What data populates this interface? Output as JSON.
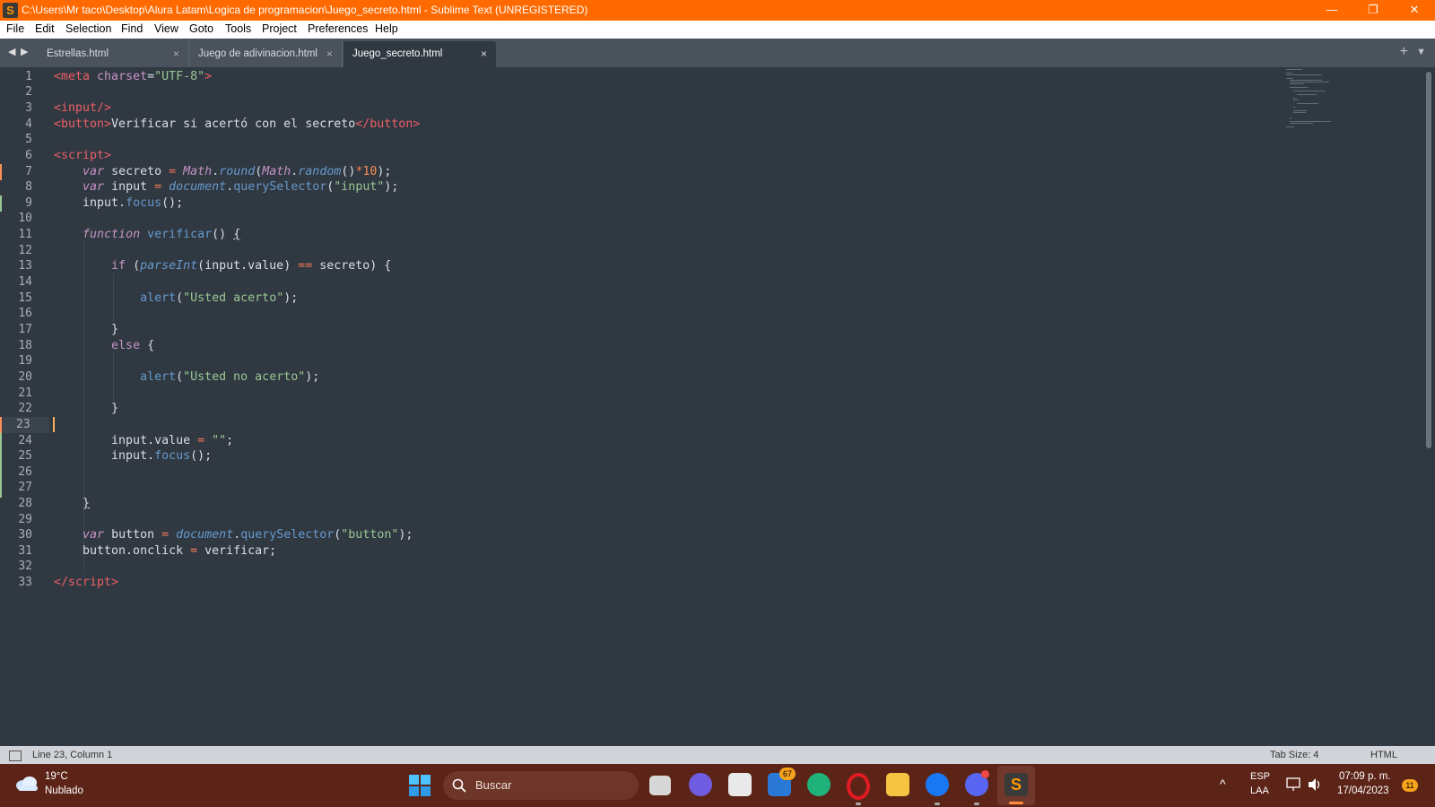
{
  "window": {
    "title": "C:\\Users\\Mr taco\\Desktop\\Alura Latam\\Logica de programacion\\Juego_secreto.html - Sublime Text (UNREGISTERED)",
    "minimize": "—",
    "restore": "❐",
    "close": "✕"
  },
  "menu": [
    "File",
    "Edit",
    "Selection",
    "Find",
    "View",
    "Goto",
    "Tools",
    "Project",
    "Preferences",
    "Help"
  ],
  "tabs": [
    {
      "label": "Estrellas.html",
      "close": "×"
    },
    {
      "label": "Juego de adivinacion.html",
      "close": "×"
    },
    {
      "label": "Juego_secreto.html",
      "close": "×"
    }
  ],
  "tabbar": {
    "plus": "+",
    "more": "▼",
    "prev": "◀",
    "next": "▶"
  },
  "editor": {
    "current_line": 23,
    "line_numbers": [
      "1",
      "2",
      "3",
      "4",
      "5",
      "6",
      "7",
      "8",
      "9",
      "10",
      "11",
      "12",
      "13",
      "14",
      "15",
      "16",
      "17",
      "18",
      "19",
      "20",
      "21",
      "22",
      "23",
      "24",
      "25",
      "26",
      "27",
      "28",
      "29",
      "30",
      "31",
      "32",
      "33"
    ]
  },
  "status": {
    "position": "Line 23, Column 1",
    "tab_size": "Tab Size: 4",
    "syntax": "HTML"
  },
  "taskbar": {
    "weather_temp": "19°C",
    "weather_desc": "Nublado",
    "search_placeholder": "Buscar",
    "mail_badge": "67",
    "lang_top": "ESP",
    "lang_bottom": "LAA",
    "time": "07:09 p. m.",
    "date": "17/04/2023",
    "notification_count": "11"
  },
  "colors": {
    "title_bar": "#ff6a00",
    "editor_bg": "#303841",
    "tab_bar": "#4a525b",
    "taskbar": "#5c2417",
    "modified_marker": "#f99157",
    "added_marker": "#99c794"
  }
}
